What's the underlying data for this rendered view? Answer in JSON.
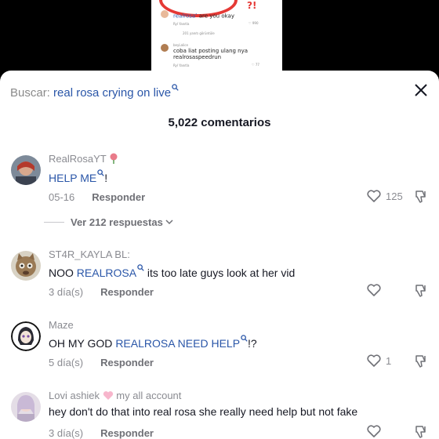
{
  "background": {
    "mark": "?!",
    "c1_user": "realrosa",
    "c1_text": "are you okay",
    "c1_meta": "Ryl    Yanıtla",
    "c1_likes": "990",
    "view_more": "201 yanıtı görüntüle",
    "c2_user": "beyLalice",
    "c2_text1": "coba liat posting ulang nya",
    "c2_text2": "realrosaspeedrun",
    "c2_meta": "Ryl    Yanıtla",
    "c2_likes": "77"
  },
  "search": {
    "label": "Buscar:",
    "query": "real rosa crying on live"
  },
  "comments_count": "5,022 comentarios",
  "comments": [
    {
      "username": "RealRosaYT",
      "text_link": "HELP ME",
      "text_after": "!",
      "date": "05-16",
      "reply_label": "Responder",
      "likes": "125",
      "view_replies": "Ver 212 respuestas"
    },
    {
      "username": "ST4R_KAYLA BL:",
      "text_before": "NOO ",
      "text_link": "REALROSA",
      "text_after": " its too late guys look at her vid",
      "date": "3 día(s)",
      "reply_label": "Responder",
      "likes": ""
    },
    {
      "username": "Maze",
      "text_before": "OH MY GOD ",
      "text_link": "REALROSA NEED HELP",
      "text_after": "!?",
      "date": "5 día(s)",
      "reply_label": "Responder",
      "likes": "1"
    },
    {
      "username_before": "Lovi ashiek",
      "username_after": "my all account",
      "text": "hey don't do that into real rosa she really need help but not fake",
      "date": "3 día(s)",
      "reply_label": "Responder",
      "likes": ""
    }
  ],
  "icons": {
    "search": "search-icon",
    "close": "close-icon",
    "like": "heart-outline-icon",
    "dislike": "thumbs-down-icon",
    "chevron": "chevron-down-icon"
  },
  "colors": {
    "link": "#2a56a8",
    "muted": "#8a8b91",
    "text": "#161823",
    "scribble": "#e53935"
  }
}
